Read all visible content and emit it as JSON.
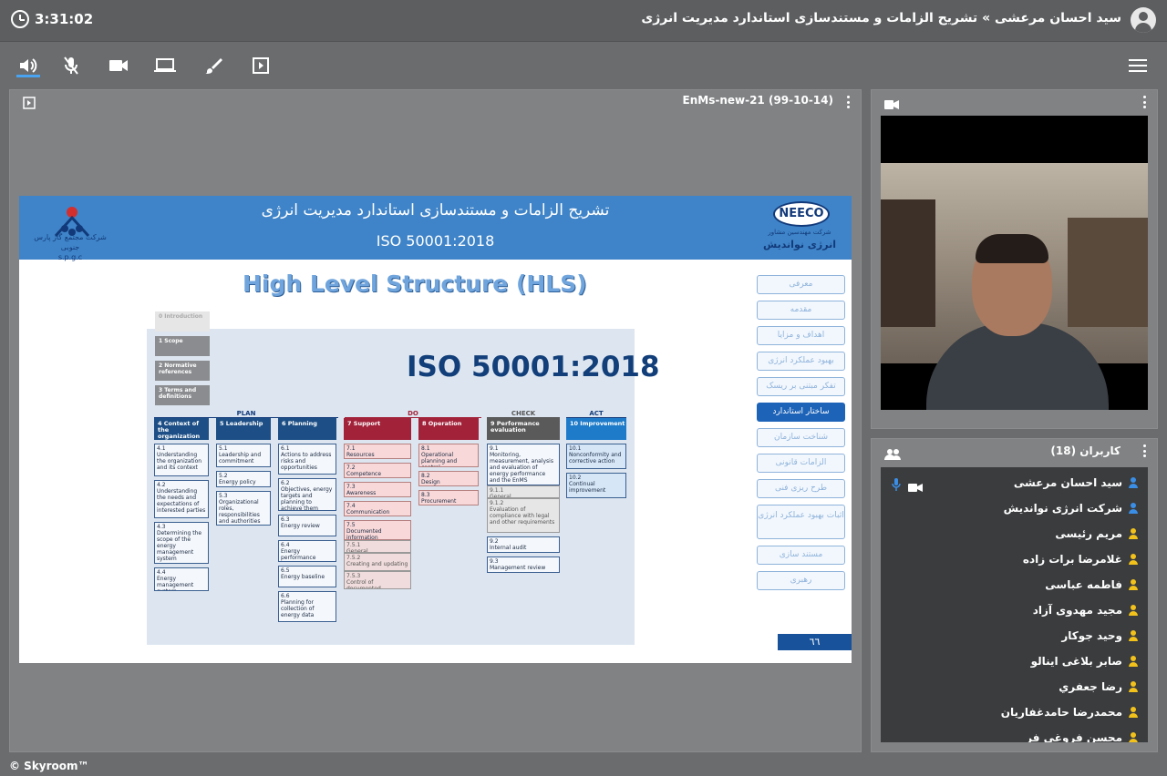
{
  "header": {
    "timer": "3:31:02",
    "title": "سید احسان مرعشی » تشریح الزامات و مستندسازی استاندارد مدیریت انرژی"
  },
  "toolbar": {
    "icons": [
      "speaker-icon",
      "mic-muted-icon",
      "camera-icon",
      "screen-share-icon",
      "brush-icon",
      "presentation-icon",
      "menu-icon"
    ],
    "accent": "#4aa3f0"
  },
  "presentation": {
    "file_title": "EnMs-new-21 (99-10-14)",
    "slide": {
      "title": "تشریح الزامات و مستندسازی استاندارد مدیریت انرژی",
      "subtitle": "ISO 50001:2018",
      "left_logo_text": "شرکت مجتمع گاز پارس جنوبی",
      "left_logo_abbr": "s.p.g.c",
      "right_logo": "NEECO",
      "right_logo_sub1": "شرکت مهندسین مشاور",
      "right_logo_sub2": "انرژی نواندیش",
      "hls_title": "High Level Structure (HLS)",
      "iso_big": "ISO 50001:2018",
      "page_number": "٦٦",
      "clauses_left": [
        {
          "label": "0  Introduction"
        },
        {
          "label": "1  Scope"
        },
        {
          "label": "2  Normative references"
        },
        {
          "label": "3  Terms and definitions"
        }
      ],
      "phases": [
        "PLAN",
        "DO",
        "CHECK",
        "ACT"
      ],
      "columns": [
        {
          "head": "4  Context of the organization",
          "color": "#1d4f86",
          "cells": [
            "4.1\nUnderstanding the organization and its context",
            "4.2\nUnderstanding the needs and expectations of interested parties",
            "4.3\nDetermining the scope of the energy management system",
            "4.4\nEnergy management system"
          ]
        },
        {
          "head": "5  Leadership",
          "color": "#1d4f86",
          "cells": [
            "5.1\nLeadership and commitment",
            "5.2\nEnergy policy",
            "5.3\nOrganizational roles, responsibilities and authorities"
          ]
        },
        {
          "head": "6  Planning",
          "color": "#1d4f86",
          "cells": [
            "6.1\nActions to address risks and opportunities",
            "6.2\nObjectives, energy targets and planning to achieve them",
            "6.3\nEnergy review",
            "6.4\nEnergy performance indicators",
            "6.5\nEnergy baseline",
            "6.6\nPlanning for collection of energy data"
          ]
        },
        {
          "head": "7  Support",
          "color": "#a2223a",
          "cells": [
            "7.1\nResources",
            "7.2\nCompetence",
            "7.3\nAwareness",
            "7.4\nCommunication",
            "7.5\nDocumented information",
            "7.5.1\nGeneral",
            "7.5.2\nCreating and updating",
            "7.5.3\nControl of documented information"
          ]
        },
        {
          "head": "8  Operation",
          "color": "#a2223a",
          "cells": [
            "8.1\nOperational planning and control",
            "8.2\nDesign",
            "8.3\nProcurement"
          ]
        },
        {
          "head": "9  Performance evaluation",
          "color": "#5a5a5a",
          "cells": [
            "9.1\nMonitoring, measurement, analysis and evaluation of energy performance and the EnMS",
            "9.1.1\nGeneral",
            "9.1.2\nEvaluation of compliance with legal and other requirements",
            "9.2\nInternal audit",
            "9.3\nManagement review"
          ]
        },
        {
          "head": "10  Improvement",
          "color": "#1e7bc9",
          "cells": [
            "10.1\nNonconformity and corrective action",
            "10.2\nContinual improvement"
          ]
        }
      ],
      "nav": [
        "معرفی",
        "مقدمه",
        "اهداف و مزایا",
        "بهبود عملکرد انرژی",
        "تفکر مبتنی بر ریسک",
        "ساختار استاندارد",
        "شناخت سازمان",
        "الزامات قانونی",
        "طرح ریزی فنی",
        "اثبات بهبود عملکرد انرژی",
        "مستند سازی",
        "رهبری"
      ],
      "nav_active_index": 5
    }
  },
  "users": {
    "title": "کاربران (18)",
    "list": [
      {
        "name": "سید احسان مرعشی",
        "color": "#3a8ee6"
      },
      {
        "name": "شرکت انرژی نواندیش",
        "color": "#3a8ee6"
      },
      {
        "name": "مریم رئیسی",
        "color": "#f2c21b"
      },
      {
        "name": "غلامرضا برات زاده",
        "color": "#f2c21b"
      },
      {
        "name": "فاطمه عباسی",
        "color": "#f2c21b"
      },
      {
        "name": "مجید مهدوی آزاد",
        "color": "#f2c21b"
      },
      {
        "name": "وحید جوکار",
        "color": "#f2c21b"
      },
      {
        "name": "صابر بلاغی اینالو",
        "color": "#f2c21b"
      },
      {
        "name": "رضا جعفري",
        "color": "#f2c21b"
      },
      {
        "name": "محمدرضا حامدغفاریان",
        "color": "#f2c21b"
      },
      {
        "name": "محسن فروغی فر",
        "color": "#f2c21b"
      }
    ]
  },
  "footer": {
    "brand": "© Skyroom™"
  }
}
